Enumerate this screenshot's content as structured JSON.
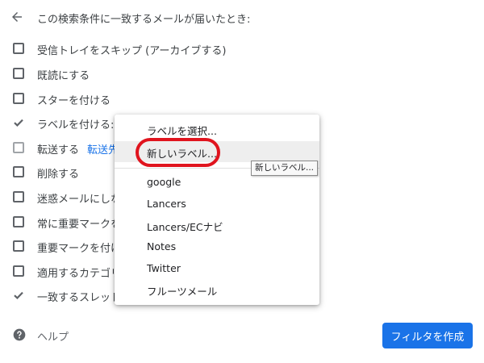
{
  "header": {
    "title": "この検索条件に一致するメールが届いたとき:"
  },
  "options": [
    {
      "label": "受信トレイをスキップ (アーカイブする)",
      "checked": false
    },
    {
      "label": "既読にする",
      "checked": false
    },
    {
      "label": "スターを付ける",
      "checked": false
    },
    {
      "label": "ラベルを付ける:",
      "checked": true
    },
    {
      "label": "転送する",
      "link": "転送先",
      "checked": false,
      "disabled": true
    },
    {
      "label": "削除する",
      "checked": false
    },
    {
      "label": "迷惑メールにしな",
      "checked": false
    },
    {
      "label": "常に重要マークを",
      "checked": false
    },
    {
      "label": "重要マークを付け",
      "checked": false
    },
    {
      "label": "適用するカテゴリ",
      "checked": false
    },
    {
      "label": "一致するスレッド",
      "checked": true
    }
  ],
  "help": {
    "label": "ヘルプ"
  },
  "create_button": {
    "label": "フィルタを作成"
  },
  "label_menu": {
    "placeholder": "ラベルを選択...",
    "new_label": "新しいラベル...",
    "labels": [
      "google",
      "Lancers",
      "Lancers/ECナビ",
      "Notes",
      "Twitter",
      "フルーツメール"
    ]
  },
  "tooltip": {
    "text": "新しいラベル..."
  },
  "colors": {
    "accent": "#1a73e8",
    "highlight": "#e0141e"
  }
}
